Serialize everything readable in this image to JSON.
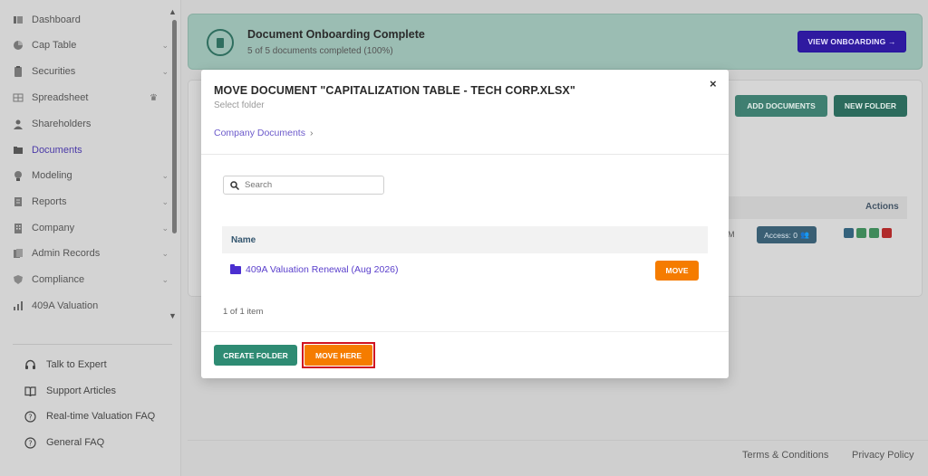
{
  "sidebar": {
    "items": [
      {
        "label": "Dashboard",
        "icon": "dashboard-icon",
        "has_caret": false,
        "active": false
      },
      {
        "label": "Cap Table",
        "icon": "pie-chart-icon",
        "has_caret": true,
        "active": false
      },
      {
        "label": "Securities",
        "icon": "clipboard-icon",
        "has_caret": true,
        "active": false
      },
      {
        "label": "Spreadsheet",
        "icon": "table-icon",
        "has_caret": false,
        "active": false,
        "badge_icon": "crown-icon"
      },
      {
        "label": "Shareholders",
        "icon": "person-icon",
        "has_caret": false,
        "active": false
      },
      {
        "label": "Documents",
        "icon": "folder-icon",
        "has_caret": false,
        "active": true
      },
      {
        "label": "Modeling",
        "icon": "lightbulb-icon",
        "has_caret": true,
        "active": false
      },
      {
        "label": "Reports",
        "icon": "report-icon",
        "has_caret": true,
        "active": false
      },
      {
        "label": "Company",
        "icon": "building-icon",
        "has_caret": true,
        "active": false
      },
      {
        "label": "Admin Records",
        "icon": "records-icon",
        "has_caret": true,
        "active": false
      },
      {
        "label": "Compliance",
        "icon": "shield-icon",
        "has_caret": true,
        "active": false
      },
      {
        "label": "409A Valuation",
        "icon": "chart-icon",
        "has_caret": false,
        "active": false
      }
    ],
    "help": [
      {
        "label": "Talk to Expert",
        "icon": "headset-icon"
      },
      {
        "label": "Support Articles",
        "icon": "book-icon"
      },
      {
        "label": "Real-time Valuation FAQ",
        "icon": "question-icon"
      },
      {
        "label": "General FAQ",
        "icon": "question-icon"
      }
    ]
  },
  "banner": {
    "title": "Document Onboarding Complete",
    "subtitle": "5 of 5 documents completed (100%)",
    "button_label": "VIEW ONBOARDING →"
  },
  "background": {
    "add_documents_label": "ADD DOCUMENTS",
    "new_folder_label": "NEW FOLDER",
    "actions_header": "Actions",
    "access_label": "Access: 0",
    "row_fragment": "M"
  },
  "modal": {
    "title": "MOVE DOCUMENT \"CAPITALIZATION TABLE - TECH CORP.XLSX\"",
    "subtitle": "Select folder",
    "close_symbol": "×",
    "breadcrumb": "Company Documents",
    "breadcrumb_chevron": "›",
    "search_placeholder": "Search",
    "column_name": "Name",
    "rows": [
      {
        "name": "409A Valuation Renewal (Aug 2026)",
        "action_label": "MOVE"
      }
    ],
    "count_text": "1 of 1 item",
    "create_folder_label": "CREATE FOLDER",
    "move_here_label": "MOVE HERE"
  },
  "footer": {
    "terms": "Terms & Conditions",
    "privacy": "Privacy Policy"
  },
  "colors": {
    "accent_purple": "#2f1aa0",
    "accent_orange": "#f57c00",
    "accent_green": "#2e8b73",
    "highlight_red": "#d1121f"
  }
}
